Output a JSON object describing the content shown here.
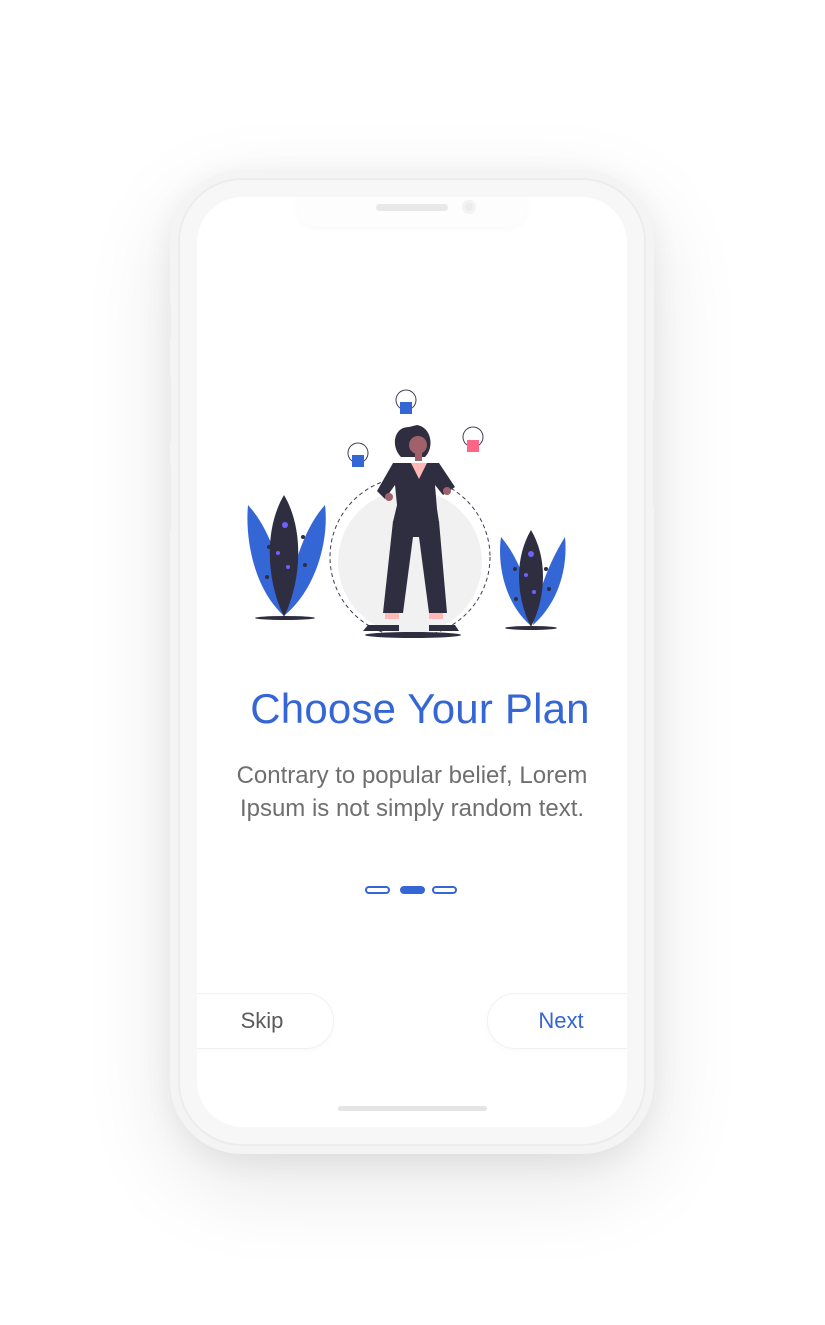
{
  "onboarding": {
    "title": "Choose Your Plan",
    "description": "Contrary to popular belief, Lorem Ipsum is not simply random text.",
    "page_indicator": {
      "total": 3,
      "current": 2
    }
  },
  "actions": {
    "skip_label": "Skip",
    "next_label": "Next"
  },
  "colors": {
    "accent": "#3566d6",
    "figure_dark": "#2f2e41",
    "pink": "#ff6584",
    "text_muted": "#6f6f6f"
  },
  "icons": {
    "illustration": "woman-with-plants-and-shirts-illustration"
  }
}
